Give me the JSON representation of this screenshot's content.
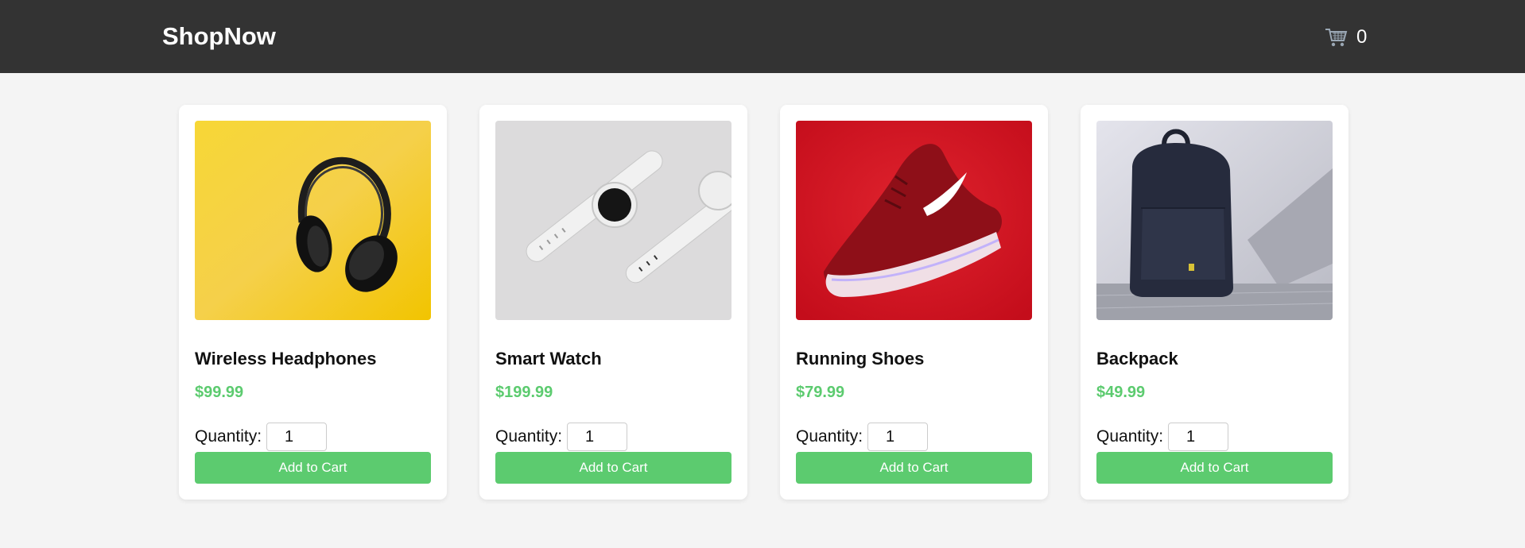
{
  "header": {
    "logo": "ShopNow",
    "cart_icon": "shopping-cart-icon",
    "cart_count": "0",
    "background": "#333333"
  },
  "products": [
    {
      "name": "Wireless Headphones",
      "price": "$99.99",
      "quantity_label": "Quantity:",
      "quantity": "1",
      "button_label": "Add to Cart",
      "image": "headphones-on-yellow-photo"
    },
    {
      "name": "Smart Watch",
      "price": "$199.99",
      "quantity_label": "Quantity:",
      "quantity": "1",
      "button_label": "Add to Cart",
      "image": "white-smartwatches-photo"
    },
    {
      "name": "Running Shoes",
      "price": "$79.99",
      "quantity_label": "Quantity:",
      "quantity": "1",
      "button_label": "Add to Cart",
      "image": "red-running-shoe-photo"
    },
    {
      "name": "Backpack",
      "price": "$49.99",
      "quantity_label": "Quantity:",
      "quantity": "1",
      "button_label": "Add to Cart",
      "image": "navy-backpack-photo"
    }
  ],
  "colors": {
    "accent": "#5ccb6f",
    "page_background": "#f4f4f4",
    "card_background": "#ffffff"
  }
}
